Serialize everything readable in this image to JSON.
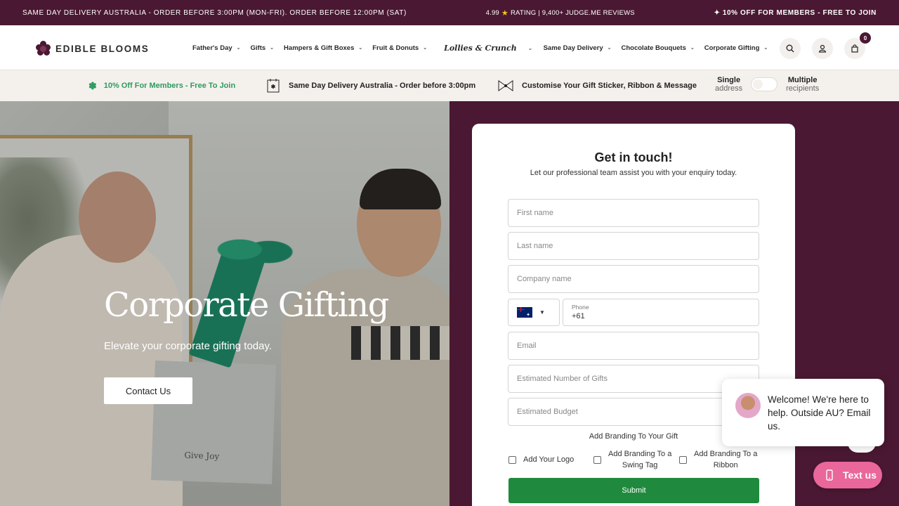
{
  "announcement": {
    "left": "SAME DAY DELIVERY AUSTRALIA - ORDER BEFORE 3:00PM (MON-FRI). ORDER BEFORE 12:00PM (SAT)",
    "rating_value": "4.99",
    "rating_text": "RATING | 9,400+ JUDGE.ME REVIEWS",
    "right": "✦ 10% OFF FOR MEMBERS - FREE TO JOIN"
  },
  "header": {
    "logo_text": "EDIBLE BLOOMS",
    "nav": [
      {
        "label": "Father's Day"
      },
      {
        "label": "Gifts"
      },
      {
        "label": "Hampers & Gift Boxes"
      },
      {
        "label": "Fruit & Donuts"
      },
      {
        "label": "Lollies & Crunch"
      },
      {
        "label": "Same Day Delivery"
      },
      {
        "label": "Chocolate Bouquets"
      },
      {
        "label": "Corporate Gifting"
      }
    ],
    "cart_count": "0"
  },
  "infobar": {
    "members": "10% Off For Members - Free To Join",
    "delivery": "Same Day Delivery Australia - Order before 3:00pm",
    "customise": "Customise Your Gift Sticker, Ribbon & Message",
    "toggle_left_title": "Single",
    "toggle_left_sub": "address",
    "toggle_right_title": "Multiple",
    "toggle_right_sub": "recipients"
  },
  "hero": {
    "title": "Corporate Gifting",
    "subtitle": "Elevate your corporate gifting today.",
    "cta": "Contact Us",
    "box_text": "Give Joy"
  },
  "form": {
    "title": "Get in touch!",
    "intro": "Let our professional team assist you with your enquiry today.",
    "first_name": "First name",
    "last_name": "Last name",
    "company": "Company name",
    "phone_label": "Phone",
    "phone_value": "+61",
    "email": "Email",
    "num_gifts": "Estimated Number of Gifts",
    "budget": "Estimated Budget",
    "branding_title": "Add Branding To Your Gift",
    "opt_logo": "Add Your Logo",
    "opt_swing_1": "Add Branding To a",
    "opt_swing_2": "Swing Tag",
    "opt_ribbon_1": "Add Branding To a",
    "opt_ribbon_2": "Ribbon",
    "submit": "Submit"
  },
  "chat": {
    "message": "Welcome! We're here to help. Outside AU? Email us.",
    "text_us": "Text us"
  },
  "colors": {
    "brand": "#4a1832",
    "green": "#1f8a3d",
    "pink": "#e9679a"
  }
}
